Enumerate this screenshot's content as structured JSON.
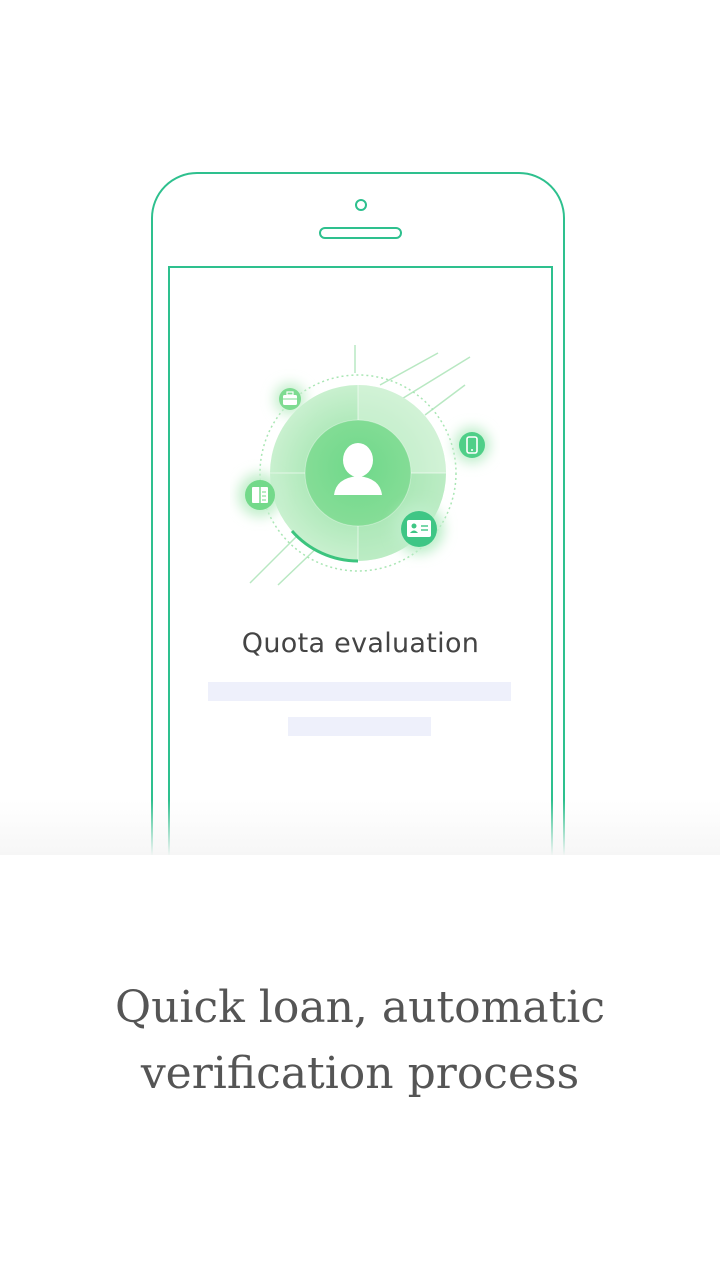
{
  "illustration": {
    "main_icon": "user-avatar-icon",
    "orbit_icons": [
      "briefcase-icon",
      "mobile-phone-icon",
      "book-icon",
      "id-card-icon"
    ],
    "accent_color": "#2ec08e",
    "light_accent_color": "#9be3a6"
  },
  "screen": {
    "title": "Quota evaluation"
  },
  "headline": {
    "line1": "Quick loan, automatic",
    "line2": "verification process"
  },
  "colors": {
    "phone_outline": "#2ec08e",
    "placeholder": "#eef0fb",
    "text": "#555555"
  }
}
